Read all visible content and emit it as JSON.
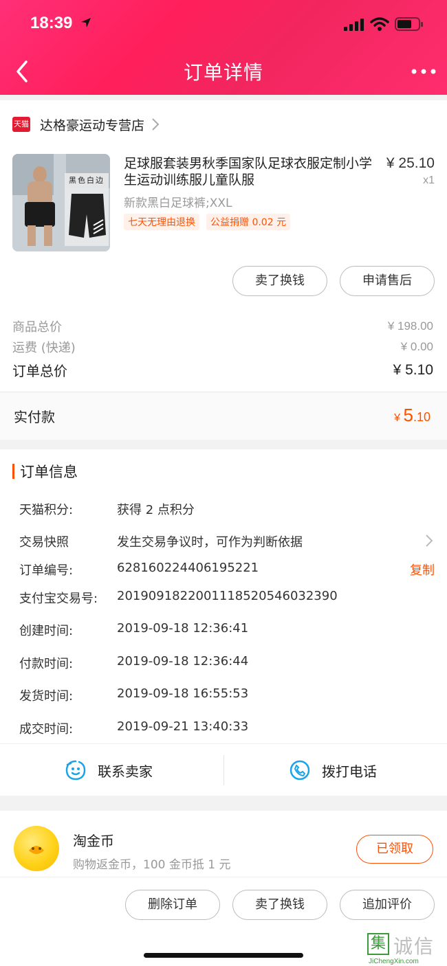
{
  "status_bar": {
    "time": "18:39"
  },
  "nav": {
    "title": "订单详情"
  },
  "shop": {
    "badge": "天猫",
    "name": "达格豪运动专营店"
  },
  "product": {
    "title": "足球服套装男秋季国家队足球衣服定制小学生运动训练服儿童队服",
    "price": "¥ 25.10",
    "quantity": "x1",
    "spec": "新款黑白足球裤;XXL",
    "image_caption": "黑色白边",
    "tags": [
      "七天无理由退换",
      "公益捐赠 0.02 元"
    ],
    "buttons": [
      "卖了换钱",
      "申请售后"
    ]
  },
  "pricing": {
    "goods_total_label": "商品总价",
    "goods_total_value": "¥ 198.00",
    "shipping_label": "运费 (快递)",
    "shipping_value": "¥ 0.00",
    "order_total_label": "订单总价",
    "order_total_value": "¥ 5.10",
    "paid_label": "实付款",
    "paid_currency": "¥",
    "paid_integer": "5",
    "paid_decimal": ".10"
  },
  "order_info": {
    "title": "订单信息",
    "copy_label": "复制",
    "rows": [
      {
        "label": "天猫积分:",
        "value": "获得 2 点积分"
      },
      {
        "label": "交易快照",
        "value": "发生交易争议时，可作为判断依据"
      },
      {
        "label": "订单编号:",
        "value": "628160224406195221"
      },
      {
        "label": "支付宝交易号:",
        "value": "2019091822001118520546032390"
      },
      {
        "label": "创建时间:",
        "value": "2019-09-18 12:36:41"
      },
      {
        "label": "付款时间:",
        "value": "2019-09-18 12:36:44"
      },
      {
        "label": "发货时间:",
        "value": "2019-09-18 16:55:53"
      },
      {
        "label": "成交时间:",
        "value": "2019-09-21 13:40:33"
      }
    ]
  },
  "contact": {
    "seller_label": "联系卖家",
    "phone_label": "拨打电话"
  },
  "coin": {
    "title": "淘金币",
    "subtitle": "购物返金币，100 金币抵 1 元",
    "button": "已领取"
  },
  "actions": [
    "删除订单",
    "卖了换钱",
    "追加评价"
  ],
  "watermark": {
    "mark": "集",
    "text": "诚信",
    "domain": "JiChengXin.com"
  },
  "colors": {
    "accent": "#ff5000",
    "header": "#ff2060",
    "tmall": "#e31b30",
    "coin": "#ffd21a"
  }
}
